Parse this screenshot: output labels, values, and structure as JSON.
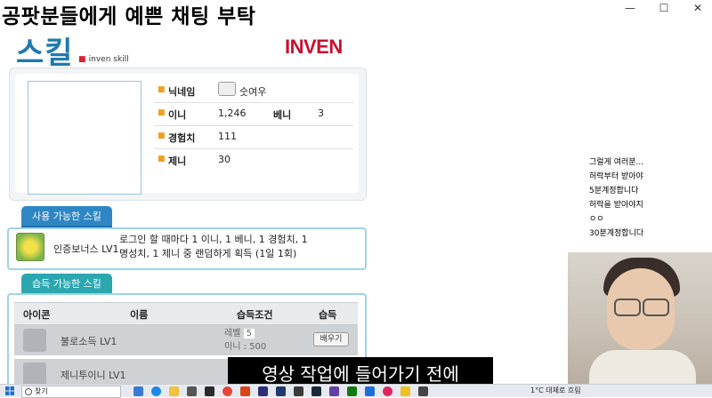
{
  "caption": {
    "top": "공팟분들에게 예쁜 채팅 부탁"
  },
  "window": {
    "minimize": "—",
    "maximize": "☐",
    "close": "✕"
  },
  "header": {
    "logo_ko": "스킬",
    "logo_en": "inven skill",
    "brand": "INVEN"
  },
  "profile": {
    "nickname_label": "닉네임",
    "nickname": "숫여우",
    "ini_label": "이니",
    "ini": "1,246",
    "beni_label": "베니",
    "beni": "3",
    "exp_label": "경험치",
    "exp": "111",
    "zeni_label": "제니",
    "zeni": "30"
  },
  "used_skills": {
    "tab": "사용 가능한 스킬",
    "items": [
      {
        "name": "인증보너스 LV1",
        "desc": "로그인 할 때마다 1 이니, 1 베니, 1 경험치, 1 명성치, 1 제니 중 랜덤하게 획득 (1일 1회)"
      }
    ]
  },
  "learnable_skills": {
    "tab": "습득 가능한 스킬",
    "columns": [
      "아이콘",
      "이름",
      "습득조건",
      "습득"
    ],
    "rows": [
      {
        "name": "불로소득 LV1",
        "cond_level": "레벨",
        "cond_level_val": "5",
        "cond_ini": "이니 : 500",
        "button": "배우기"
      },
      {
        "name": "제니투이니 LV1"
      }
    ]
  },
  "chat": [
    {
      "nick": "",
      "msg": "그럴게 여러분..."
    },
    {
      "nick": "",
      "msg": "허락부터 받아야"
    },
    {
      "nick": "",
      "msg": "5분계정합니다"
    },
    {
      "nick": "",
      "msg": "허락을 받아야지"
    },
    {
      "nick": "",
      "msg": "ㅇㅇ"
    },
    {
      "nick": "",
      "msg": "30분계정합니다"
    }
  ],
  "subtitle": "영상 작업에 들어가기 전에",
  "taskbar": {
    "search_placeholder": "찾기",
    "tray_text": "1°C 대체로 흐림"
  }
}
